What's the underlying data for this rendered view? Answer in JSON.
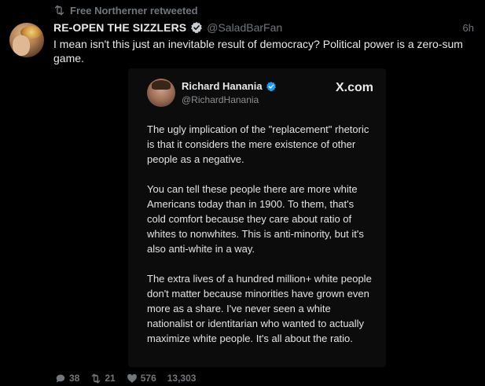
{
  "retweet": {
    "label": "Free Northerner retweeted",
    "icon": "retweet-icon"
  },
  "tweet": {
    "display_name": "RE-OPEN THE SIZZLERS",
    "handle": "@SaladBarFan",
    "timestamp": "6h",
    "text": "I mean isn't this just an inevitable result of democracy? Political power is a zero-sum game.",
    "verified_color": "#1d9bf0"
  },
  "card": {
    "name": "Richard Hanania",
    "handle": "@RichardHanania",
    "source": "X.com",
    "paragraphs": [
      "The ugly implication of the \"replacement\" rhetoric is that it considers the mere existence of other people as a negative.",
      "You can tell these people there are more white Americans today than in 1900. To them, that's cold comfort because they care about ratio of whites to nonwhites. This is anti-minority, but it's also anti-white in a way.",
      "The extra lives of a hundred million+ white people don't matter because minorities have grown even more as a share. I've never seen a white nationalist or identitarian who wanted to actually maximize white people. It's all about the ratio."
    ]
  },
  "actions": {
    "replies": "38",
    "retweets": "21",
    "likes": "576",
    "views": "13,303"
  },
  "colors": {
    "background": "#000000",
    "muted": "#71767b",
    "text": "#e7e9ea",
    "card_bg": "#0c0c0c"
  }
}
